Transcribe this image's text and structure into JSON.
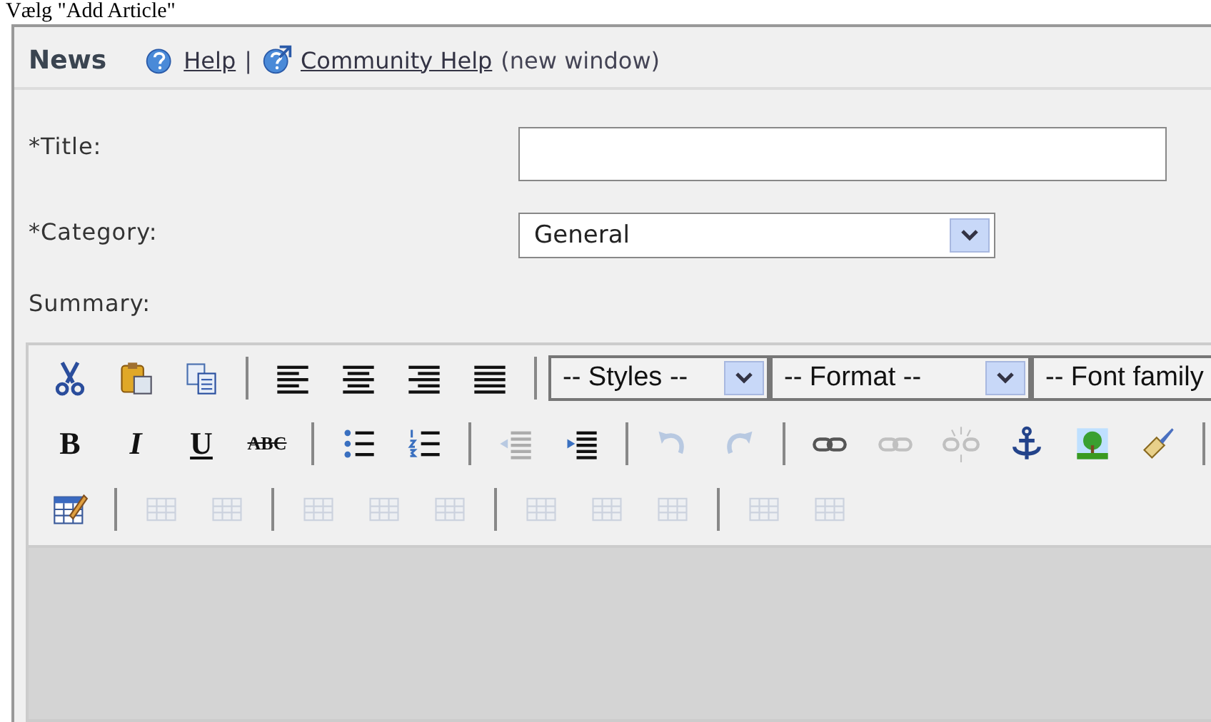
{
  "page_title": "Vælg \"Add Article\"",
  "header": {
    "title": "News",
    "help_link": "Help",
    "separator": "|",
    "community_link": "Community Help",
    "community_note": "(new window)"
  },
  "form": [
    {
      "kind": "text",
      "label": "*Title:"
    },
    {
      "kind": "select",
      "label": "*Category:",
      "value": "General"
    },
    {
      "kind": "label",
      "label": "Summary:"
    }
  ],
  "toolbar": [
    [
      {
        "kind": "button",
        "disabled": false
      },
      {
        "kind": "button",
        "disabled": false
      },
      {
        "kind": "button",
        "disabled": false
      },
      {
        "kind": "separator"
      },
      {
        "kind": "button",
        "disabled": false
      },
      {
        "kind": "button",
        "disabled": false
      },
      {
        "kind": "button",
        "disabled": false
      },
      {
        "kind": "button",
        "disabled": false
      },
      {
        "kind": "separator"
      },
      {
        "kind": "select",
        "text": "-- Styles --"
      },
      {
        "kind": "select",
        "text": "-- Format --"
      },
      {
        "kind": "select",
        "text": "-- Font family"
      }
    ],
    [
      {
        "kind": "text",
        "text": "B"
      },
      {
        "kind": "text",
        "text": "I"
      },
      {
        "kind": "text",
        "text": "U"
      },
      {
        "kind": "text",
        "text": "ABC"
      },
      {
        "kind": "separator"
      },
      {
        "kind": "button",
        "disabled": false
      },
      {
        "kind": "button",
        "disabled": false
      },
      {
        "kind": "separator"
      },
      {
        "kind": "button",
        "disabled": true
      },
      {
        "kind": "button",
        "disabled": false
      },
      {
        "kind": "separator"
      },
      {
        "kind": "button",
        "disabled": true
      },
      {
        "kind": "button",
        "disabled": true
      },
      {
        "kind": "separator"
      },
      {
        "kind": "button",
        "disabled": false
      },
      {
        "kind": "button",
        "disabled": true
      },
      {
        "kind": "button",
        "disabled": true
      },
      {
        "kind": "button",
        "disabled": false
      },
      {
        "kind": "button",
        "disabled": false
      },
      {
        "kind": "button",
        "disabled": false
      },
      {
        "kind": "separator"
      }
    ],
    [
      {
        "kind": "button",
        "disabled": false
      },
      {
        "kind": "separator"
      },
      {
        "kind": "button",
        "disabled": true
      },
      {
        "kind": "button",
        "disabled": true
      },
      {
        "kind": "separator"
      },
      {
        "kind": "button",
        "disabled": true
      },
      {
        "kind": "button",
        "disabled": true
      },
      {
        "kind": "button",
        "disabled": true
      },
      {
        "kind": "separator"
      },
      {
        "kind": "button",
        "disabled": true
      },
      {
        "kind": "button",
        "disabled": true
      },
      {
        "kind": "button",
        "disabled": true
      },
      {
        "kind": "separator"
      },
      {
        "kind": "button",
        "disabled": true
      },
      {
        "kind": "button",
        "disabled": true
      }
    ]
  ]
}
